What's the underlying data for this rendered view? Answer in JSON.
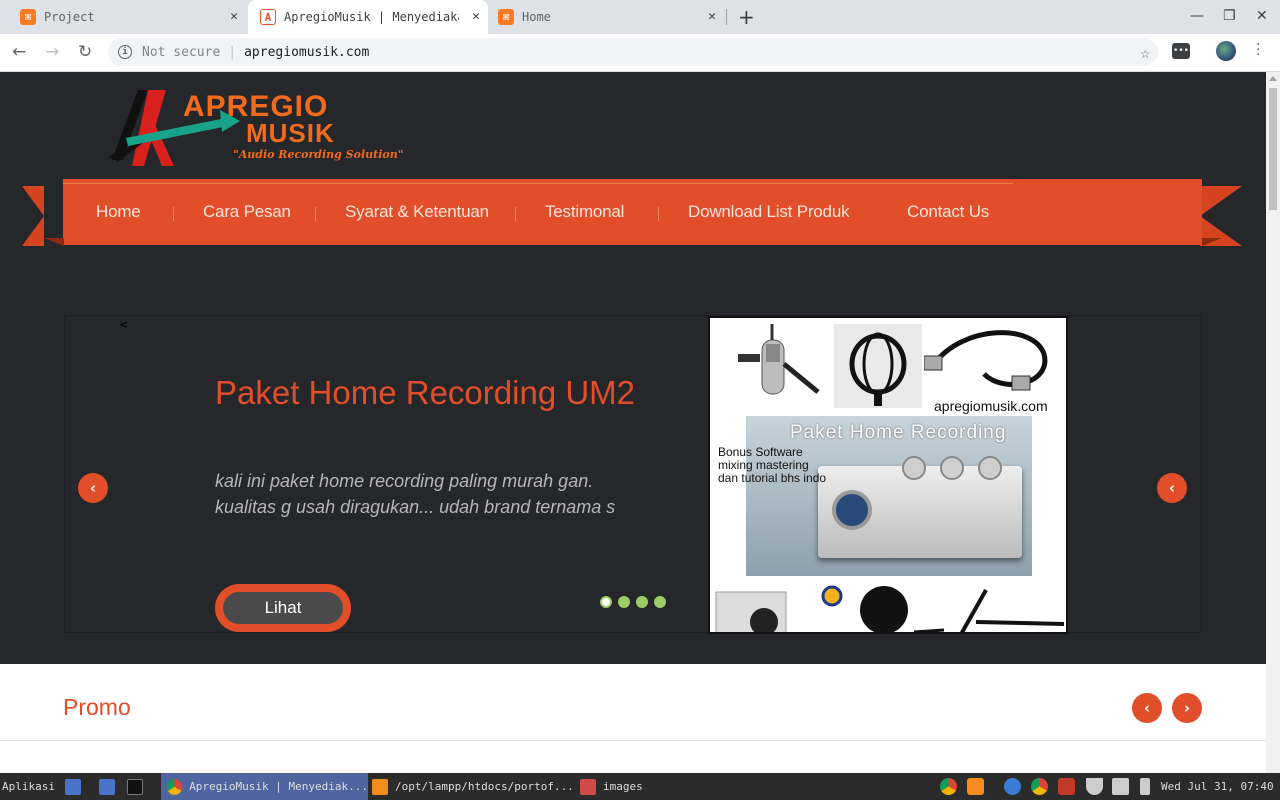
{
  "browser": {
    "tabs": [
      {
        "title": "Project",
        "active": false
      },
      {
        "title": "ApregioMusik | Menyediaka",
        "active": true
      },
      {
        "title": "Home",
        "active": false
      }
    ],
    "security_label": "Not secure",
    "url": "apregiomusik.com"
  },
  "site": {
    "logo": {
      "line1": "APREGIO",
      "line2": "MUSIK",
      "tagline": "\"Audio Recording Solution\""
    },
    "nav": [
      {
        "label": "Home"
      },
      {
        "label": "Cara Pesan"
      },
      {
        "label": "Syarat & Ketentuan"
      },
      {
        "label": "Testimonal"
      },
      {
        "label": "Download List Produk"
      },
      {
        "label": "Contact Us"
      }
    ],
    "slider": {
      "prev_hint": "<",
      "title": "Paket Home Recording UM2",
      "description": "kali ini paket home recording paling murah gan. kualitas g usah diragukan... udah brand ternama s",
      "button_label": "Lihat",
      "dots": 4,
      "active_dot": 1,
      "image": {
        "url_text": "apregiomusik.com",
        "banner": "Paket Home Recording",
        "bonus": [
          "Bonus Software",
          "mixing mastering",
          "dan tutorial bhs indo"
        ]
      }
    },
    "promo": {
      "title": "Promo"
    },
    "accent_color": "#e24e2a",
    "hero_bg": "#25272a"
  },
  "taskbar": {
    "start": "Aplikasi",
    "windows": [
      {
        "label": "ApregioMusik | Menyediak...",
        "active": true
      },
      {
        "label": "/opt/lampp/htdocs/portof...",
        "active": false
      },
      {
        "label": "images",
        "active": false
      }
    ],
    "clock": "Wed Jul 31, 07:40"
  }
}
